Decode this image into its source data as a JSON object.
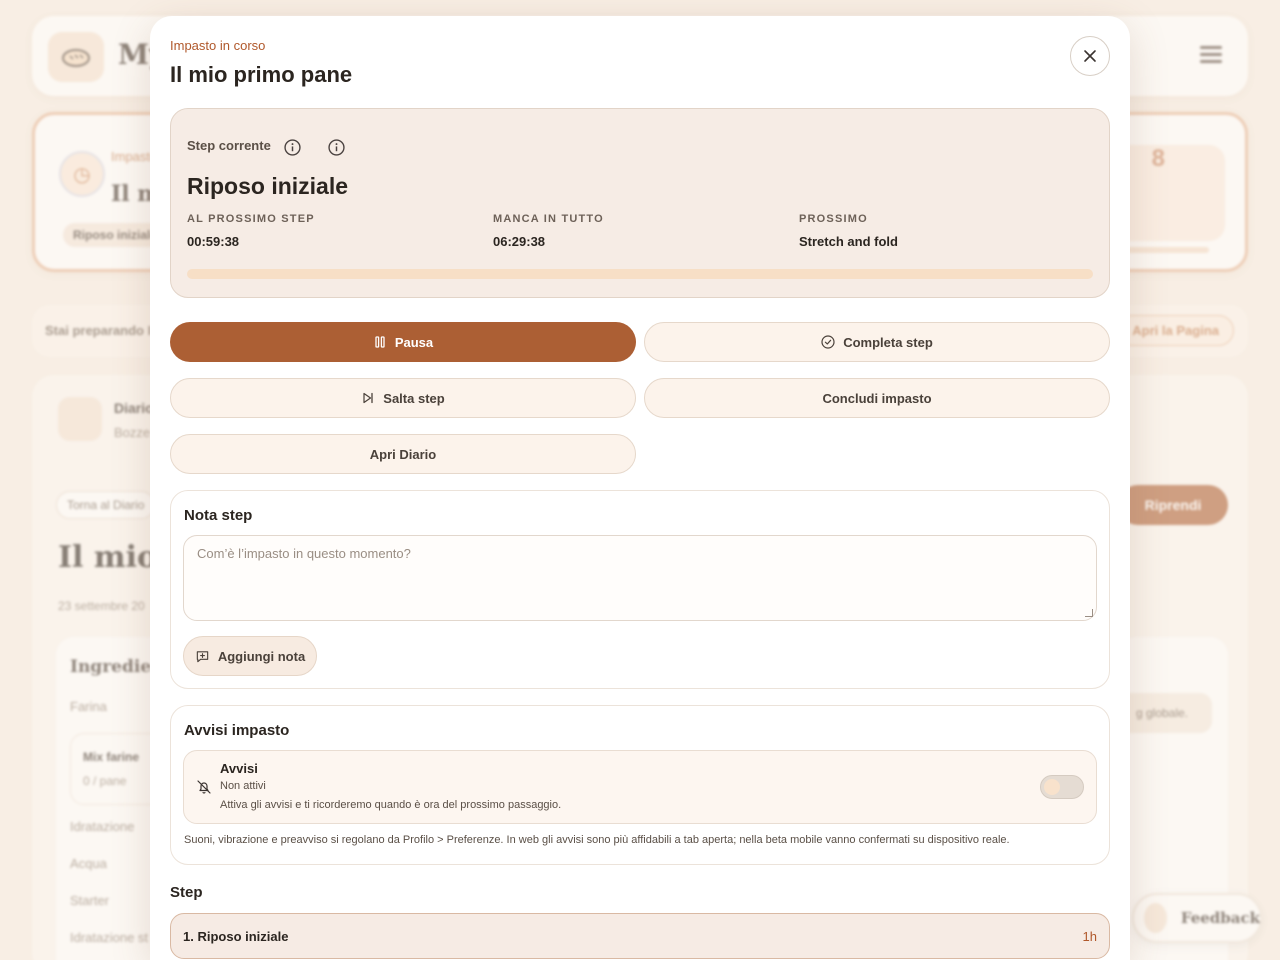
{
  "background": {
    "brand": "My",
    "active_label": "Impasto",
    "active_title": "Il mi",
    "active_chip": "Riposo iniziale",
    "timer_partial": "8",
    "strip_text": "Stai preparando Il",
    "strip_button": "Apri la Pagina",
    "journal_title": "Diario",
    "journal_sub": "Bozze",
    "back_link": "Torna al Diario",
    "page_title": "Il mio",
    "date": "23 settembre 20",
    "ingredients_title": "Ingredienti",
    "ingredients": [
      "Farina",
      "Idratazione",
      "Acqua",
      "Starter",
      "Idratazione st"
    ],
    "mix_title": "Mix farine",
    "mix_sub": "0 / pane",
    "resume_button": "Riprendi",
    "global_note": "g globale.",
    "feedback": "Feedback"
  },
  "modal": {
    "eyebrow": "Impasto in corso",
    "title": "Il mio primo pane",
    "current_step": {
      "label": "Step corrente",
      "name": "Riposo iniziale",
      "columns": [
        {
          "key": "AL PROSSIMO STEP",
          "value": "00:59:38"
        },
        {
          "key": "MANCA IN TUTTO",
          "value": "06:29:38"
        },
        {
          "key": "PROSSIMO",
          "value": "Stretch and fold"
        }
      ],
      "progress": 0.0
    },
    "buttons": {
      "pause": "Pausa",
      "complete": "Completa step",
      "skip": "Salta step",
      "finish": "Concludi impasto",
      "journal": "Apri Diario"
    },
    "note": {
      "title": "Nota step",
      "placeholder": "Com’è l’impasto in questo momento?",
      "add_button": "Aggiungi nota"
    },
    "alerts": {
      "title": "Avvisi impasto",
      "name": "Avvisi",
      "state": "Non attivi",
      "description": "Attiva gli avvisi e ti ricorderemo quando è ora del prossimo passaggio.",
      "enabled": false,
      "footnote": "Suoni, vibrazione e preavviso si regolano da Profilo > Preferenze. In web gli avvisi sono più affidabili a tab aperta; nella beta mobile vanno confermati su dispositivo reale."
    },
    "steps": {
      "title": "Step",
      "items": [
        {
          "label": "1. Riposo iniziale",
          "duration": "1h"
        }
      ]
    }
  },
  "colors": {
    "accent": "#ac5f34",
    "eyebrow": "#b0582b",
    "card_bg": "#f6ece5",
    "progress_track": "#f7dfc6"
  }
}
